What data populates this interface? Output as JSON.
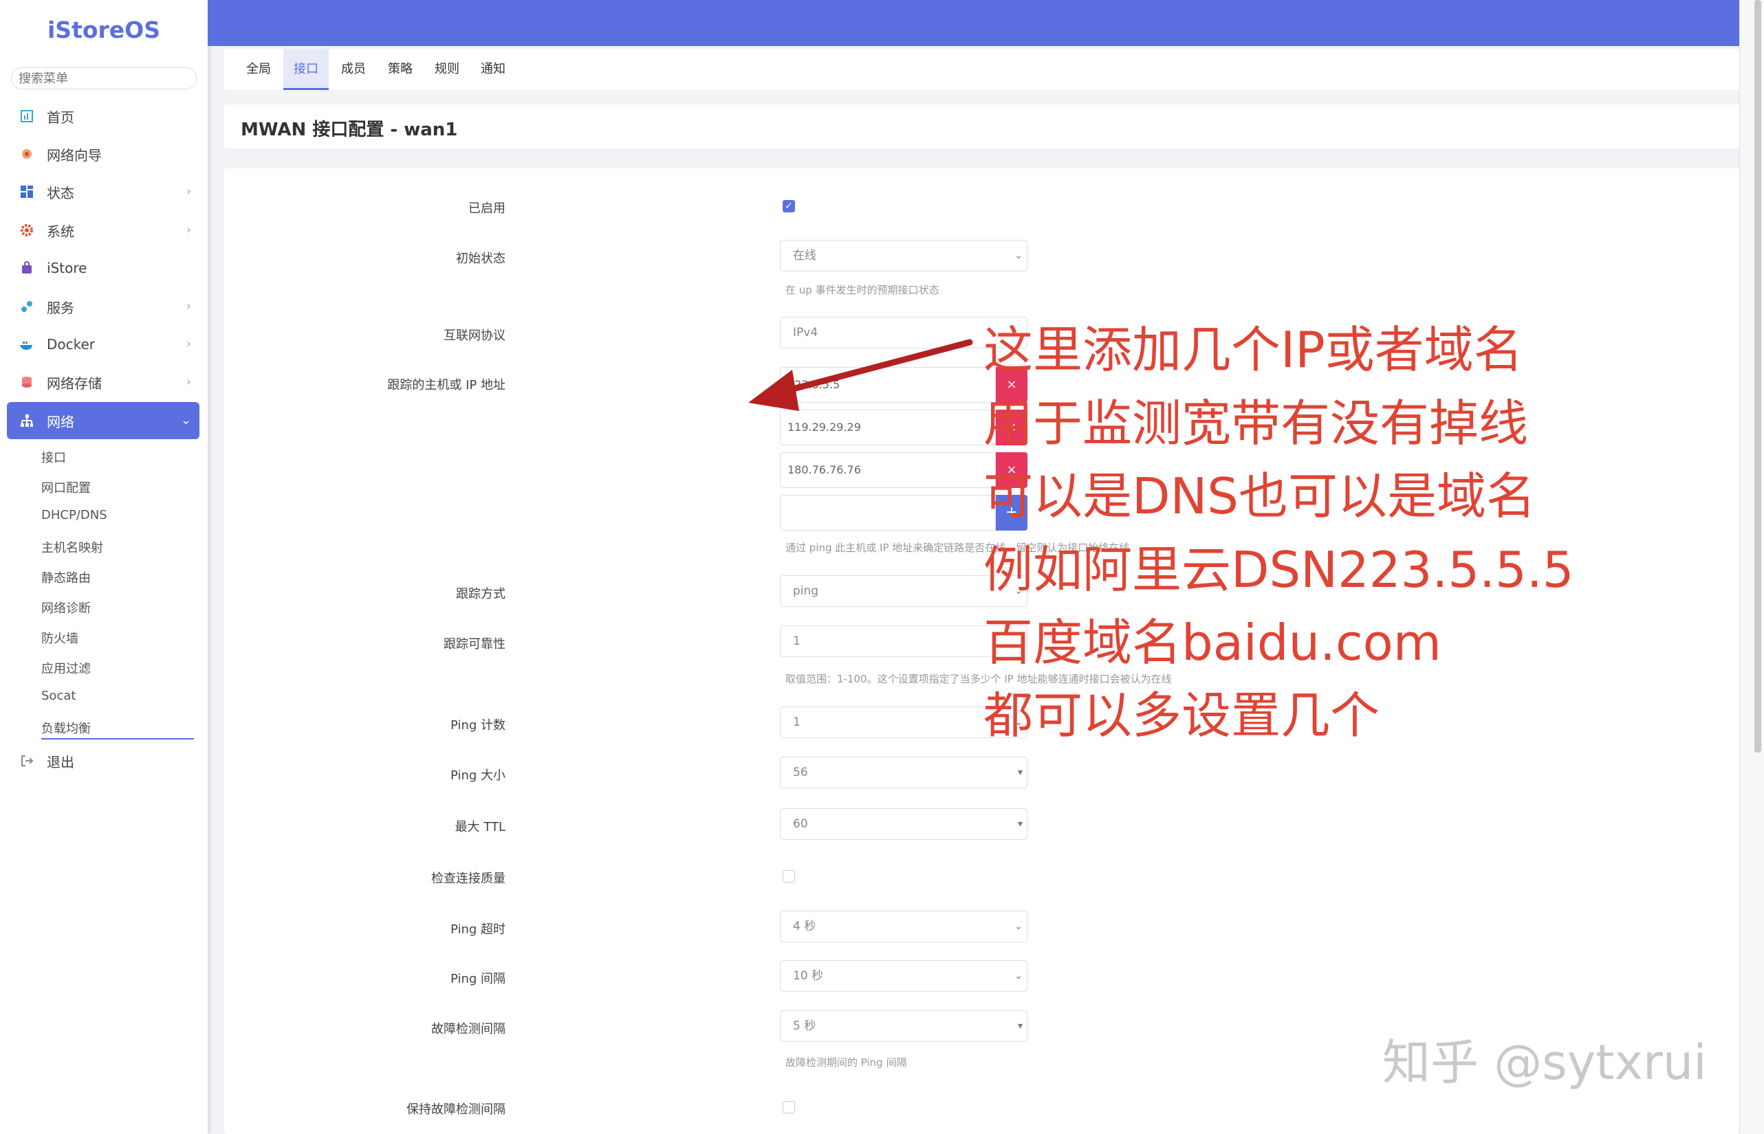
{
  "brand": "iStoreOS",
  "search": {
    "placeholder": "搜索菜单"
  },
  "colors": {
    "accent": "#5b6fe0",
    "danger": "#e7365d",
    "annotation": "#e04434"
  },
  "sidebar": {
    "items": [
      {
        "label": "首页",
        "icon": "dashboard-icon",
        "has_children": false
      },
      {
        "label": "网络向导",
        "icon": "globe-icon",
        "has_children": false
      },
      {
        "label": "状态",
        "icon": "grid-icon",
        "has_children": true
      },
      {
        "label": "系统",
        "icon": "gear-icon",
        "has_children": true
      },
      {
        "label": "iStore",
        "icon": "store-icon",
        "has_children": false
      },
      {
        "label": "服务",
        "icon": "puzzle-icon",
        "has_children": true
      },
      {
        "label": "Docker",
        "icon": "docker-icon",
        "has_children": true
      },
      {
        "label": "网络存储",
        "icon": "storage-icon",
        "has_children": true
      },
      {
        "label": "网络",
        "icon": "network-icon",
        "has_children": true,
        "active": true
      }
    ],
    "sub_items": [
      "接口",
      "网口配置",
      "DHCP/DNS",
      "主机名映射",
      "静态路由",
      "网络诊断",
      "防火墙",
      "应用过滤",
      "Socat",
      "负载均衡"
    ],
    "logout": "退出"
  },
  "tabs": [
    "全局",
    "接口",
    "成员",
    "策略",
    "规则",
    "通知"
  ],
  "active_tab": "接口",
  "page_title": "MWAN 接口配置 - wan1",
  "form": {
    "enabled": {
      "label": "已启用",
      "checked": true
    },
    "initial_state": {
      "label": "初始状态",
      "value": "在线",
      "hint": "在 up 事件发生时的预期接口状态"
    },
    "protocol": {
      "label": "互联网协议",
      "value": "IPv4"
    },
    "track_ip": {
      "label": "跟踪的主机或 IP 地址",
      "values": [
        "223.5.5.5",
        "119.29.29.29",
        "180.76.76.76",
        ""
      ],
      "delete_symbol": "×",
      "add_symbol": "+",
      "hint": "通过 ping 此主机或 IP 地址来确定链路是否在线。留空则认为接口始终在线"
    },
    "track_method": {
      "label": "跟踪方式",
      "value": "ping"
    },
    "reliability": {
      "label": "跟踪可靠性",
      "value": "1",
      "hint": "取值范围：1-100。这个设置项指定了当多少个 IP 地址能够连通时接口会被认为在线"
    },
    "ping_count": {
      "label": "Ping 计数",
      "value": "1"
    },
    "ping_size": {
      "label": "Ping 大小",
      "value": "56"
    },
    "max_ttl": {
      "label": "最大 TTL",
      "value": "60"
    },
    "check_quality": {
      "label": "检查连接质量",
      "checked": false
    },
    "ping_timeout": {
      "label": "Ping 超时",
      "value": "4 秒"
    },
    "ping_interval": {
      "label": "Ping 间隔",
      "value": "10 秒"
    },
    "failure_interval": {
      "label": "故障检测间隔",
      "value": "5 秒",
      "hint": "故障检测期间的 Ping 间隔"
    },
    "keep_failure_interval": {
      "label": "保持故障检测间隔",
      "checked": false
    }
  },
  "annotation": {
    "lines": [
      "这里添加几个IP或者域名",
      "用于监测宽带有没有掉线",
      "可以是DNS也可以是域名",
      "例如阿里云DSN223.5.5.5",
      "百度域名baidu.com",
      "都可以多设置几个"
    ]
  },
  "watermark": "知乎 @sytxrui"
}
